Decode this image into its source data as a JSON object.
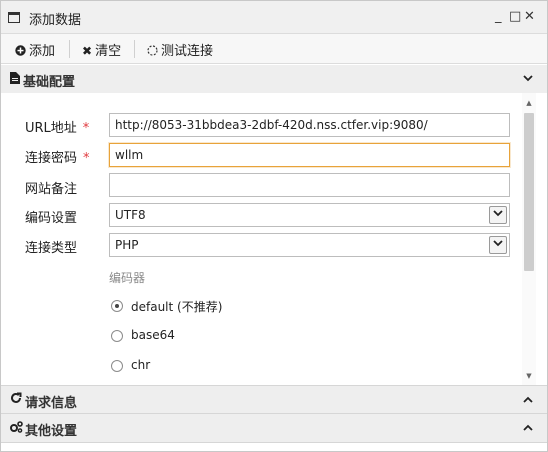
{
  "window": {
    "title": "添加数据",
    "minimize": "_",
    "maximize": "□",
    "close": "✕"
  },
  "toolbar": {
    "add_label": "添加",
    "add_icon": "plus-circle-icon",
    "clear_label": "清空",
    "clear_icon": "x-icon",
    "test_label": "测试连接",
    "test_icon": "spinner-icon"
  },
  "sections": {
    "basic": {
      "label": "基础配置",
      "icon": "file-icon",
      "expanded": true
    },
    "request": {
      "label": "请求信息",
      "icon": "refresh-icon",
      "expanded": false
    },
    "other": {
      "label": "其他设置",
      "icon": "gears-icon",
      "expanded": false
    }
  },
  "form": {
    "url": {
      "label": "URL地址",
      "required": "*",
      "value": "http://8053-31bbdea3-2dbf-420d.nss.ctfer.vip:9080/"
    },
    "password": {
      "label": "连接密码",
      "required": "*",
      "value": "wllm"
    },
    "note": {
      "label": "网站备注",
      "value": ""
    },
    "encoding": {
      "label": "编码设置",
      "selected": "UTF8"
    },
    "type": {
      "label": "连接类型",
      "selected": "PHP"
    },
    "encoder": {
      "group_label": "编码器",
      "options": [
        {
          "label": "default (不推荐)",
          "checked": true
        },
        {
          "label": "base64",
          "checked": false
        },
        {
          "label": "chr",
          "checked": false
        }
      ]
    }
  },
  "colors": {
    "focus_border": "#e8a33a",
    "required_star": "#e0393e"
  }
}
